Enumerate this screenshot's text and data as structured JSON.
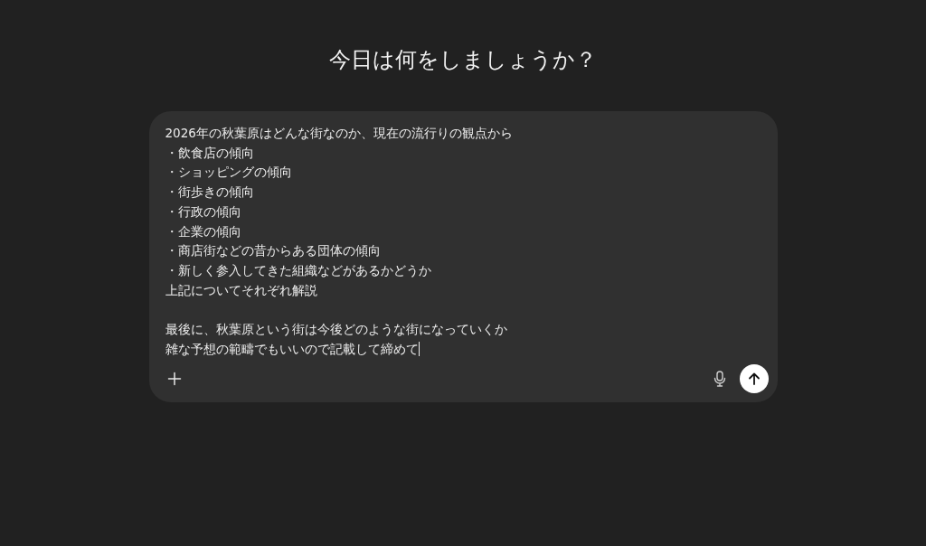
{
  "heading": "今日は何をしましょうか？",
  "composer": {
    "paragraphs": [
      [
        "2026年の秋葉原はどんな街なのか、現在の流行りの観点から",
        "・飲食店の傾向",
        "・ショッピングの傾向",
        "・街歩きの傾向",
        "・行政の傾向",
        "・企業の傾向",
        "・商店街などの昔からある団体の傾向",
        "・新しく参入してきた組織などがあるかどうか",
        "上記についてそれぞれ解説"
      ],
      [
        "最後に、秋葉原という街は今後どのような街になっていくか",
        "雑な予想の範疇でもいいので記載して締めて"
      ]
    ]
  }
}
